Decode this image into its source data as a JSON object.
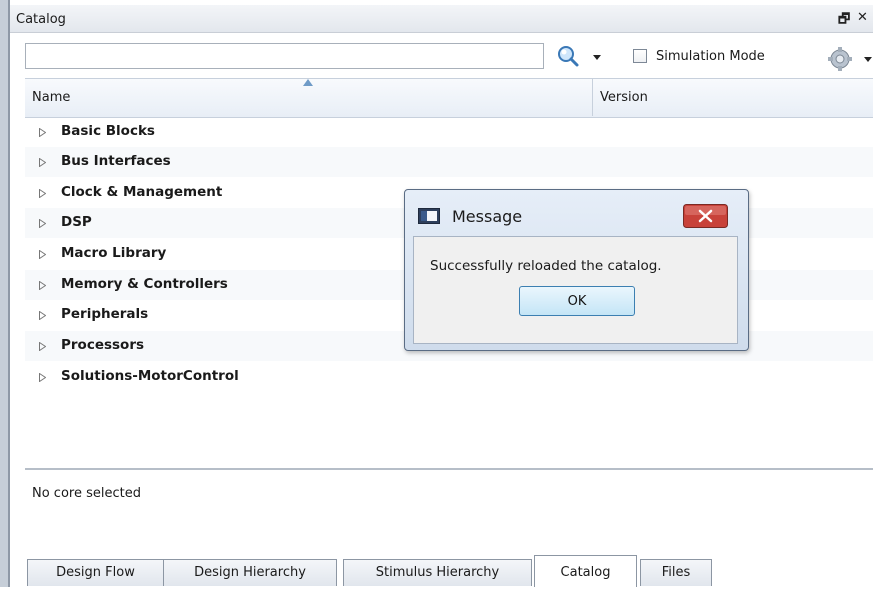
{
  "panel": {
    "title": "Catalog",
    "restore_glyph": "🗗",
    "close_glyph": "✕"
  },
  "toolbar": {
    "search_value": "",
    "search_icon": "magnifier-icon",
    "simulation_mode_label": "Simulation Mode",
    "simulation_mode_checked": false,
    "options_icon": "gear-icon"
  },
  "columns": {
    "name": "Name",
    "version": "Version"
  },
  "categories": [
    "Basic Blocks",
    "Bus Interfaces",
    "Clock & Management",
    "DSP",
    "Macro Library",
    "Memory & Controllers",
    "Peripherals",
    "Processors",
    "Solutions-MotorControl"
  ],
  "description": {
    "text": "No core selected"
  },
  "tabs": [
    {
      "label": "Design Flow",
      "active": false
    },
    {
      "label": "Design Hierarchy",
      "active": false
    },
    {
      "label": "Stimulus Hierarchy",
      "active": false
    },
    {
      "label": "Catalog",
      "active": true
    },
    {
      "label": "Files",
      "active": false
    }
  ],
  "dialog": {
    "title": "Message",
    "message": "Successfully reloaded the catalog.",
    "ok_label": "OK",
    "close_color": "#c8423a"
  }
}
